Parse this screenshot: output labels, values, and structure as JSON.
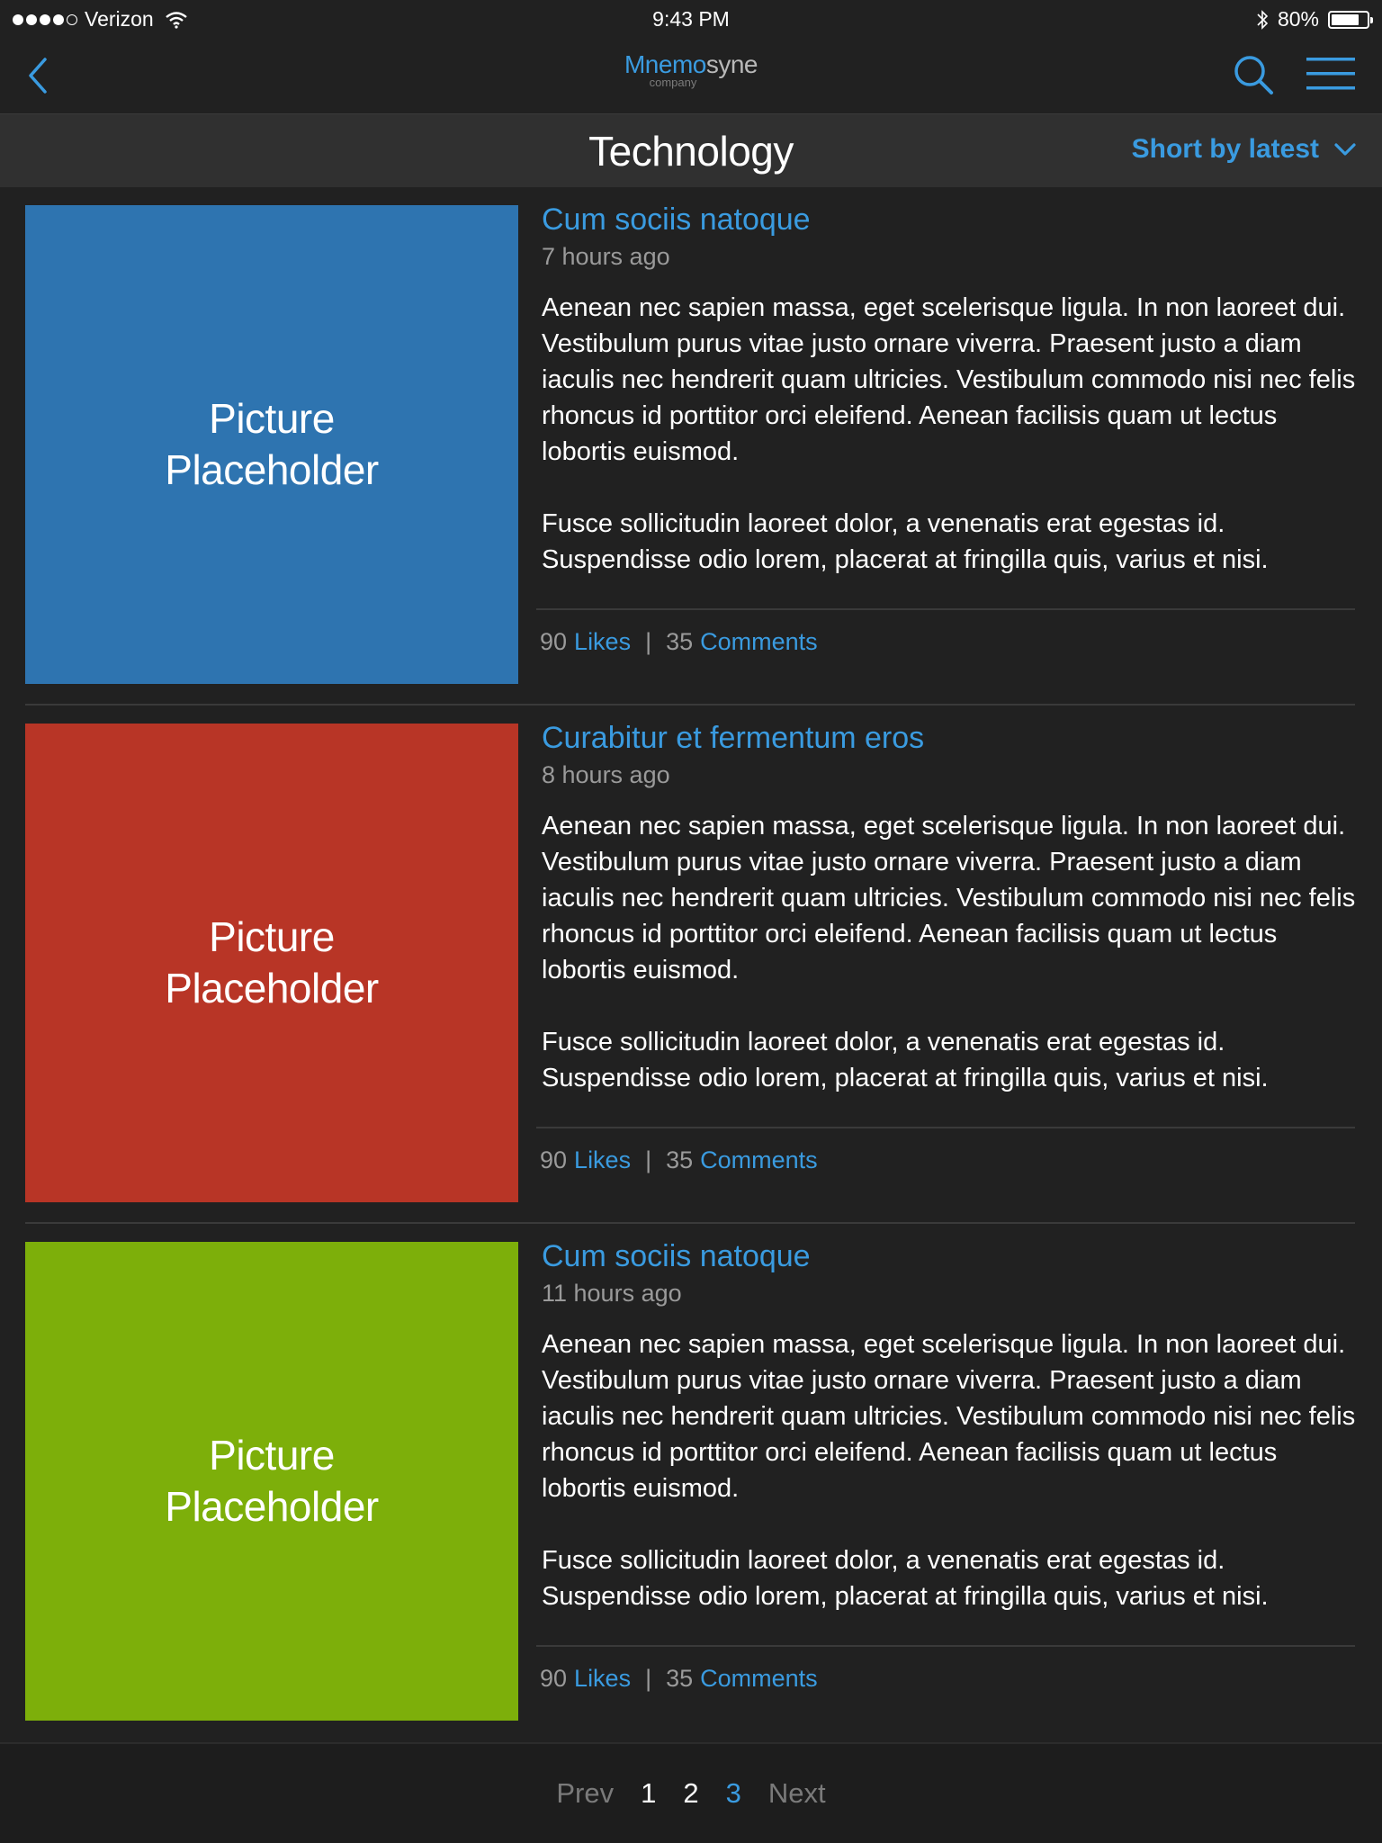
{
  "status_bar": {
    "carrier": "Verizon",
    "time": "9:43 PM",
    "battery": "80%",
    "battery_level": 0.8,
    "signal_bars_filled": 4,
    "signal_bars_total": 5
  },
  "nav": {
    "logo_part1": "Mnemo",
    "logo_part2": "syne",
    "logo_sub": "company",
    "icons": [
      "back-chevron-icon",
      "search-icon",
      "hamburger-menu-icon"
    ]
  },
  "category": {
    "title": "Technology",
    "sort_label": "Short by latest"
  },
  "posts": [
    {
      "picture_label_line1": "Picture",
      "picture_label_line2": "Placeholder",
      "picture_color": "#2e74b0",
      "title": "Cum sociis natoque",
      "time": "7 hours ago",
      "body_p1": "Aenean nec sapien massa, eget scelerisque ligula. In non laoreet dui. Vestibulum purus vitae justo ornare viverra. Praesent justo a diam iaculis nec hendrerit quam ultricies. Vestibulum commodo nisi nec felis rhoncus id porttitor orci eleifend. Aenean facilisis quam ut lectus lobortis euismod.",
      "body_p2": "Fusce sollicitudin laoreet dolor, a venenatis erat egestas id. Suspendisse odio lorem, placerat at fringilla quis, varius et nisi.",
      "likes_count": "90",
      "likes_label": "Likes",
      "comments_count": "35",
      "comments_label": "Comments"
    },
    {
      "picture_label_line1": "Picture",
      "picture_label_line2": "Placeholder",
      "picture_color": "#b83526",
      "title": "Curabitur et fermentum eros",
      "time": "8 hours ago",
      "body_p1": "Aenean nec sapien massa, eget scelerisque ligula. In non laoreet dui. Vestibulum purus vitae justo ornare viverra. Praesent justo a diam iaculis nec hendrerit quam ultricies. Vestibulum commodo nisi nec felis rhoncus id porttitor orci eleifend. Aenean facilisis quam ut lectus lobortis euismod.",
      "body_p2": "Fusce sollicitudin laoreet dolor, a venenatis erat egestas id. Suspendisse odio lorem, placerat at fringilla quis, varius et nisi.",
      "likes_count": "90",
      "likes_label": "Likes",
      "comments_count": "35",
      "comments_label": "Comments"
    },
    {
      "picture_label_line1": "Picture",
      "picture_label_line2": "Placeholder",
      "picture_color": "#7daf0a",
      "title": "Cum sociis natoque",
      "time": "11 hours ago",
      "body_p1": "Aenean nec sapien massa, eget scelerisque ligula. In non laoreet dui. Vestibulum purus vitae justo ornare viverra. Praesent justo a diam iaculis nec hendrerit quam ultricies. Vestibulum commodo nisi nec felis rhoncus id porttitor orci eleifend. Aenean facilisis quam ut lectus lobortis euismod.",
      "body_p2": "Fusce sollicitudin laoreet dolor, a venenatis erat egestas id. Suspendisse odio lorem, placerat at fringilla quis, varius et nisi.",
      "likes_count": "90",
      "likes_label": "Likes",
      "comments_count": "35",
      "comments_label": "Comments"
    }
  ],
  "pagination": {
    "prev": "Prev",
    "pages": [
      "1",
      "2",
      "3"
    ],
    "current": "3",
    "next": "Next"
  },
  "colors": {
    "accent": "#3a9be0",
    "background": "#212121",
    "category_bar": "#303030"
  }
}
